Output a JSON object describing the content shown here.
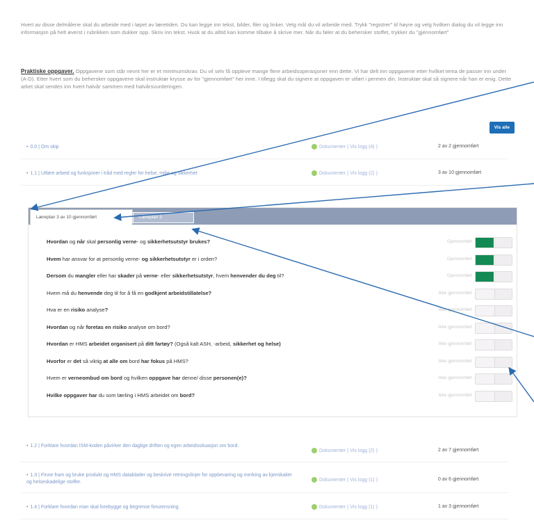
{
  "intro": "Hvert av disse delmålene skal du arbeide med i løpet av læretiden. Du kan legge inn tekst, bilder, filer og linker. Velg mål du vil arbeide med. Trykk \"registrer\" til høyre og velg hvilken dialog du vil legge inn informasjon på helt øverst i rubrikken som dukker opp. Skriv inn tekst. Husk at du alltid kan komme tilbake å skrive mer. Når du føler at du behersker stoffet, trykker du \"gjennomført\"",
  "practical": {
    "heading": "Praktiske oppgaver.",
    "text": " Oppgavene som står nevnt her er et minimumskrav.  Du vil selv få oppleve mange flere arbeidsoperasjoner enn dette. Vi har delt inn oppgavene etter hvilket tema de passer inn under (A-D). Etter hvert som du behersker oppgavene skal instruktør krysse av for \"gjennomført\" her inne. I tillegg skal du signere at oppgaven er utført i permen din. Instruktør skal så signere når han er enig. Dette arket skal sendes inn hvert halvår sammen med halvårsvurderingen."
  },
  "view_all": "Vis alle",
  "modules": [
    {
      "title": "0.0 | Om skip",
      "doc": "Dokumenter ( Vis logg (4) )",
      "status": "2 av 2 gjennomført"
    },
    {
      "title": "1.1 | Utføre arbeid og funksjoner i tråd med regler for helse, miljø og sikkerhet",
      "doc": "Dokumenter ( Vis logg (2) )",
      "status": "3 av 10 gjennomført"
    },
    {
      "title": "1.2 | Forklare hvordan ISM-koden påvirker den daglige driften og egen arbeidssituasjon om bord.",
      "doc": "Dokumenter ( Vis logg (2) )",
      "status": "2 av 7 gjennomført"
    },
    {
      "title": "1.3 | Finne fram og bruke produkt og HMS datablader og beskrive retningslinjer for oppbevaring og merking av kjemikalier og helseskadelige stoffer.",
      "doc": "Dokumenter ( Vis logg (1) )",
      "status": "0 av 6 gjennomført"
    },
    {
      "title": "1.4 | Forklare hvordan man skal forebygge og begrense forurensning.",
      "doc": "Dokumenter ( Vis logg (1) )",
      "status": "1 av 3 gjennomført"
    }
  ],
  "tabs": {
    "active": "Læreplan 3 av 10 gjennomført",
    "inactive": "Læreplan 3"
  },
  "questions": [
    {
      "parts": [
        [
          "b",
          "Hvordan"
        ],
        [
          "n",
          " og "
        ],
        [
          "b",
          "når"
        ],
        [
          "n",
          " skal "
        ],
        [
          "b",
          "personlig"
        ],
        [
          "n",
          " "
        ],
        [
          "b",
          "verne"
        ],
        [
          "n",
          "- og "
        ],
        [
          "b",
          "sikkerhetsutstyr brukes?"
        ]
      ],
      "status": "Gjennomført",
      "done": true
    },
    {
      "parts": [
        [
          "b",
          "Hvem"
        ],
        [
          "n",
          " har ansvar for at personlig verne- "
        ],
        [
          "b",
          "og sikkerhetsutstyr"
        ],
        [
          "n",
          " er i orden?"
        ]
      ],
      "status": "Gjennomført",
      "done": true
    },
    {
      "parts": [
        [
          "b",
          "Dersom"
        ],
        [
          "n",
          " du "
        ],
        [
          "b",
          "mangler"
        ],
        [
          "n",
          " eller har "
        ],
        [
          "b",
          "skader"
        ],
        [
          "n",
          " på "
        ],
        [
          "b",
          "verne"
        ],
        [
          "n",
          "- eller "
        ],
        [
          "b",
          "sikkerhetsutstyr"
        ],
        [
          "n",
          ", hvem "
        ],
        [
          "b",
          "henvender du deg"
        ],
        [
          "n",
          " til?"
        ]
      ],
      "status": "Gjennomført",
      "done": true
    },
    {
      "parts": [
        [
          "n",
          "Hvem må du "
        ],
        [
          "b",
          "henvende"
        ],
        [
          "n",
          " deg til for å få en "
        ],
        [
          "b",
          "godkjent arbeidstillatelse?"
        ]
      ],
      "status": "Ikke gjennomført",
      "done": false
    },
    {
      "parts": [
        [
          "n",
          "Hva er en "
        ],
        [
          "b",
          "risiko"
        ],
        [
          "n",
          " analyse"
        ],
        [
          "b",
          "?"
        ]
      ],
      "status": "Ikke gjennomført",
      "done": false
    },
    {
      "parts": [
        [
          "b",
          "Hvordan"
        ],
        [
          "n",
          " og når "
        ],
        [
          "b",
          "foretas en risiko"
        ],
        [
          "n",
          " analyse om bord?"
        ]
      ],
      "status": "Ikke gjennomført",
      "done": false
    },
    {
      "parts": [
        [
          "b",
          "Hvordan"
        ],
        [
          "n",
          " er HMS "
        ],
        [
          "b",
          "arbeidet organisert"
        ],
        [
          "n",
          " på "
        ],
        [
          "b",
          "ditt fartøy?"
        ],
        [
          "n",
          " (Også kalt ASH, -arbeid, "
        ],
        [
          "b",
          "sikkerhet og helse)"
        ]
      ],
      "status": "Ikke gjennomført",
      "done": false
    },
    {
      "parts": [
        [
          "b",
          "Hvorfor"
        ],
        [
          "n",
          " er "
        ],
        [
          "b",
          "det"
        ],
        [
          "n",
          " så viktig "
        ],
        [
          "b",
          "at alle om"
        ],
        [
          "n",
          " bord "
        ],
        [
          "b",
          "har fokus"
        ],
        [
          "n",
          " på HMS?"
        ]
      ],
      "status": "Ikke gjennomført",
      "done": false
    },
    {
      "parts": [
        [
          "n",
          "Hvem er "
        ],
        [
          "b",
          "verneombud om bord"
        ],
        [
          "n",
          " og hvilken "
        ],
        [
          "b",
          "oppgave har"
        ],
        [
          "n",
          " denne/ disse "
        ],
        [
          "b",
          "personen(e)?"
        ]
      ],
      "status": "Ikke gjennomført",
      "done": false
    },
    {
      "parts": [
        [
          "b",
          "Hvilke oppgaver har"
        ],
        [
          "n",
          " du som lærling i HMS arbeidet om "
        ],
        [
          "b",
          "bord?"
        ]
      ],
      "status": "Ikke gjennomført",
      "done": false
    }
  ],
  "colors": {
    "accent": "#1e6fb8",
    "done": "#138a54",
    "arrow": "#2a6ab0"
  }
}
